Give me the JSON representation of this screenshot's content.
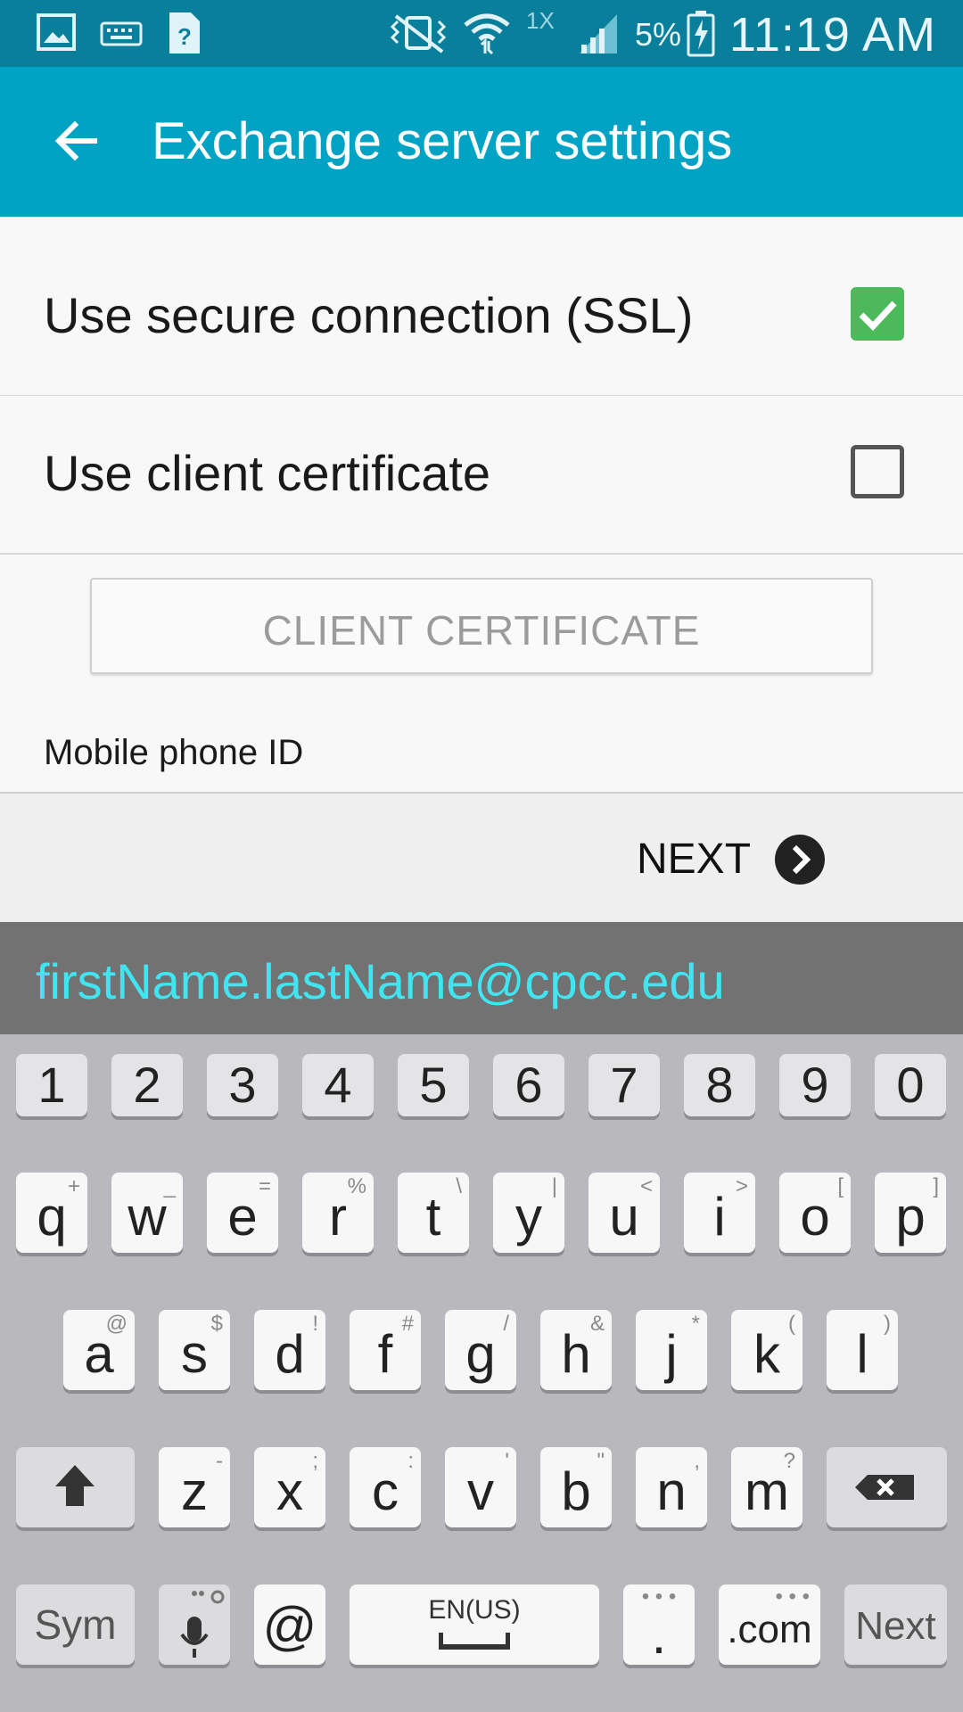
{
  "status": {
    "network": "1X",
    "battery_pct": "5%",
    "time": "11:19 AM",
    "icons": [
      "gallery-icon",
      "keyboard-icon",
      "help-doc-icon",
      "vibrate-icon",
      "wifi-icon",
      "signal-icon",
      "battery-charging-icon"
    ]
  },
  "appbar": {
    "title": "Exchange server settings",
    "back_icon": "back-arrow-icon"
  },
  "settings": {
    "ssl_label": "Use secure connection (SSL)",
    "ssl_checked": true,
    "client_cert_label": "Use client certificate",
    "client_cert_checked": false,
    "client_cert_button": "CLIENT CERTIFICATE",
    "mobile_id_label": "Mobile phone ID"
  },
  "footer": {
    "next_label": "NEXT",
    "next_icon": "chevron-right-icon"
  },
  "suggestion": {
    "text": "firstName.lastName@cpcc.edu"
  },
  "keyboard": {
    "numbers": [
      "1",
      "2",
      "3",
      "4",
      "5",
      "6",
      "7",
      "8",
      "9",
      "0"
    ],
    "row1": [
      {
        "key": "q",
        "alt": "+"
      },
      {
        "key": "w",
        "alt": "_"
      },
      {
        "key": "e",
        "alt": "="
      },
      {
        "key": "r",
        "alt": "%"
      },
      {
        "key": "t",
        "alt": "\\"
      },
      {
        "key": "y",
        "alt": "|"
      },
      {
        "key": "u",
        "alt": "<"
      },
      {
        "key": "i",
        "alt": ">"
      },
      {
        "key": "o",
        "alt": "["
      },
      {
        "key": "p",
        "alt": "]"
      }
    ],
    "row2": [
      {
        "key": "a",
        "alt": "@"
      },
      {
        "key": "s",
        "alt": "$"
      },
      {
        "key": "d",
        "alt": "!"
      },
      {
        "key": "f",
        "alt": "#"
      },
      {
        "key": "g",
        "alt": "/"
      },
      {
        "key": "h",
        "alt": "&"
      },
      {
        "key": "j",
        "alt": "*"
      },
      {
        "key": "k",
        "alt": "("
      },
      {
        "key": "l",
        "alt": ")"
      }
    ],
    "row3": [
      {
        "key": "z",
        "alt": "-"
      },
      {
        "key": "x",
        "alt": ";"
      },
      {
        "key": "c",
        "alt": ":"
      },
      {
        "key": "v",
        "alt": "'"
      },
      {
        "key": "b",
        "alt": "\""
      },
      {
        "key": "n",
        "alt": ","
      },
      {
        "key": "m",
        "alt": "?"
      }
    ],
    "sym_label": "Sym",
    "at_label": "@",
    "space_label": "EN(US)",
    "period_label": ".",
    "com_label": ".com",
    "next_label": "Next",
    "accent": "#3fe6f2"
  }
}
